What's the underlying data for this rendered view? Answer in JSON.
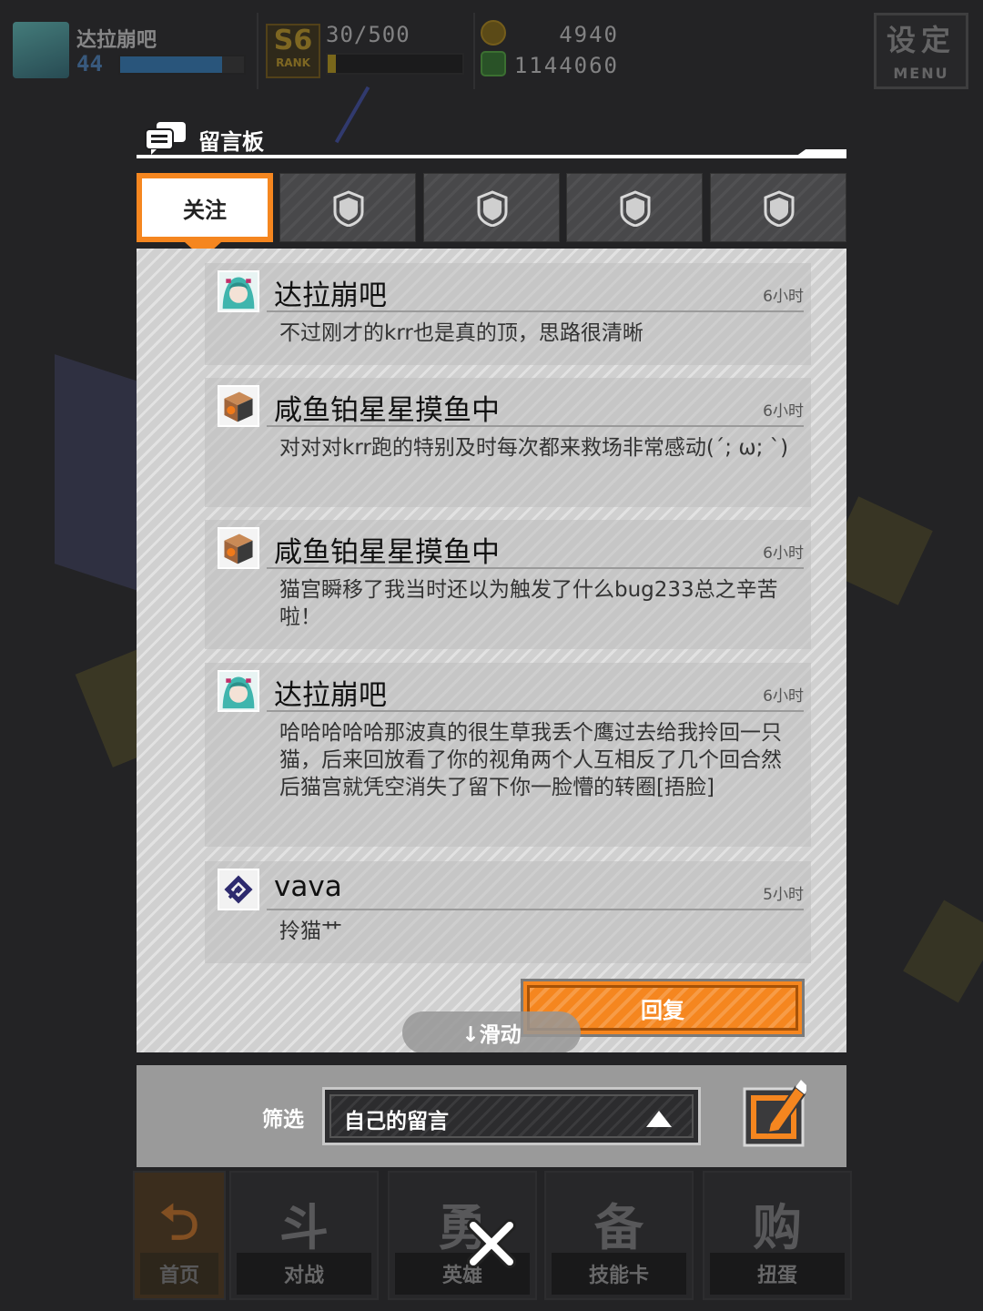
{
  "topbar": {
    "player_name": "达拉崩吧",
    "level": "44",
    "xp_fraction": 0.82,
    "rank_line1": "S6",
    "rank_line2": "RANK",
    "stamina": "30/500",
    "stamina_fraction": 0.06,
    "coins": "4940",
    "cash": "1144060",
    "menu_label": "设定",
    "menu_sub": "MENU"
  },
  "dialog": {
    "title": "留言板",
    "tabs": [
      {
        "label": "关注",
        "active": true
      },
      {
        "label": "",
        "icon": "shield-icon"
      },
      {
        "label": "",
        "icon": "shield-icon"
      },
      {
        "label": "",
        "icon": "shield-icon"
      },
      {
        "label": "",
        "icon": "shield-icon"
      }
    ]
  },
  "messages": [
    {
      "name": "达拉崩吧",
      "time": "6小时",
      "text": "不过刚才的krr也是真的顶，思路很清晰",
      "avatar": "miku-avatar"
    },
    {
      "name": "咸鱼铂星星摸鱼中",
      "time": "6小时",
      "text": "对对对krr跑的特别及时每次都来救场非常感动(´; ω; `)",
      "avatar": "box-avatar"
    },
    {
      "name": "咸鱼铂星星摸鱼中",
      "time": "6小时",
      "text": "猫宫瞬移了我当时还以为触发了什么bug233总之辛苦啦！",
      "avatar": "box-avatar"
    },
    {
      "name": "达拉崩吧",
      "time": "6小时",
      "text": "哈哈哈哈哈那波真的很生草我丢个鹰过去给我拎回一只猫，后来回放看了你的视角两个人互相反了几个回合然后猫宫就凭空消失了留下你一脸懵的转圈[捂脸]",
      "avatar": "miku-avatar"
    },
    {
      "name": "vava",
      "time": "5小时",
      "text": "拎猫艹",
      "avatar": "logo-avatar"
    }
  ],
  "reply_label": "回复",
  "scroll_hint": "↓滑动",
  "filter": {
    "label": "筛选",
    "value": "自己的留言"
  },
  "bottom_nav": [
    {
      "icon_text": "⮌",
      "label": "首页"
    },
    {
      "icon_text": "斗",
      "label": "对战"
    },
    {
      "icon_text": "勇",
      "label": "英雄"
    },
    {
      "icon_text": "备",
      "label": "技能卡"
    },
    {
      "icon_text": "购",
      "label": "扭蛋"
    }
  ],
  "colors": {
    "accent": "#f5861f",
    "panel": "#d0d0d0",
    "background": "#232325"
  }
}
